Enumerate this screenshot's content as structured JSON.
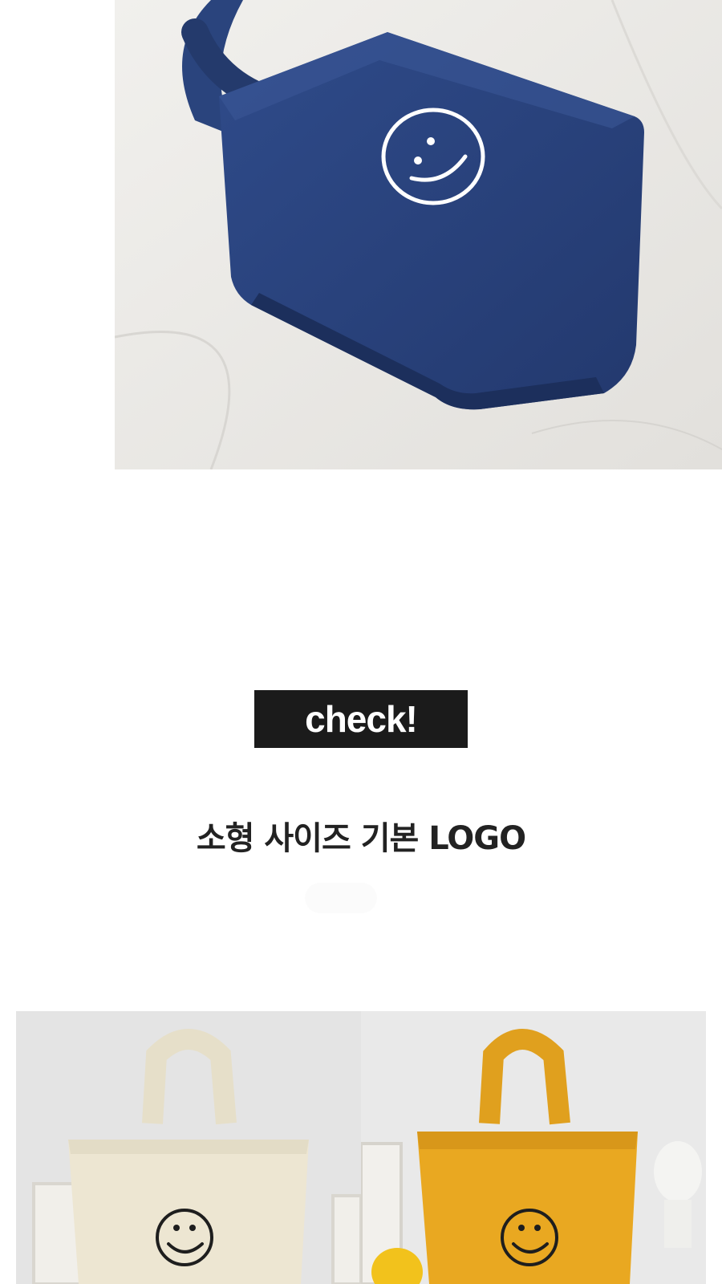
{
  "photos": {
    "top": {
      "alt": "navy-smile-tote",
      "bag_color": "#2c4784"
    },
    "bottom_left": {
      "alt": "ivory-smile-tote",
      "bag_color": "#ede6d2"
    },
    "bottom_right": {
      "alt": "yellow-smile-tote",
      "bag_color": "#e9a821"
    }
  },
  "badge": {
    "label": "check!"
  },
  "section": {
    "title": "소형 사이즈 기본 LOGO"
  }
}
